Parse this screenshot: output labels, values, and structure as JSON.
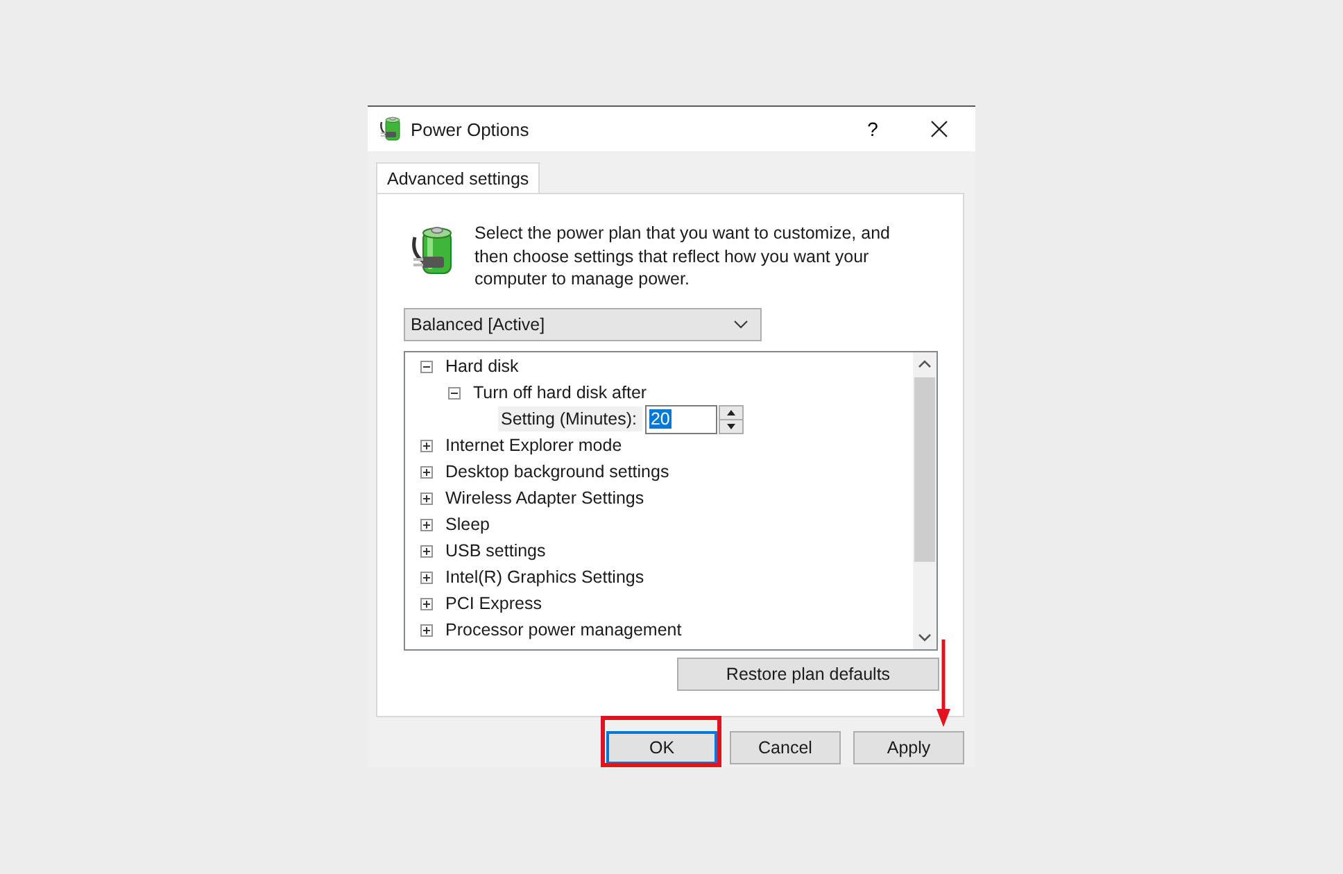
{
  "window": {
    "title": "Power Options",
    "help": "?"
  },
  "tabs": [
    {
      "label": "Advanced settings",
      "selected": true
    }
  ],
  "intro": "Select the power plan that you want to customize, and then choose settings that reflect how you want your computer to manage power.",
  "plan_dropdown": {
    "value": "Balanced [Active]"
  },
  "tree": {
    "items": [
      {
        "kind": "group",
        "label": "Hard disk",
        "expanded": true,
        "selected": false,
        "children": [
          {
            "kind": "group",
            "label": "Turn off hard disk after",
            "expanded": true,
            "selected": false,
            "children": [
              {
                "kind": "setting",
                "label": "Setting (Minutes):",
                "value": "20",
                "selected": true
              }
            ]
          }
        ]
      },
      {
        "kind": "group",
        "label": "Internet Explorer mode",
        "expanded": false,
        "selected": false
      },
      {
        "kind": "group",
        "label": "Desktop background settings",
        "expanded": false,
        "selected": false
      },
      {
        "kind": "group",
        "label": "Wireless Adapter Settings",
        "expanded": false,
        "selected": false
      },
      {
        "kind": "group",
        "label": "Sleep",
        "expanded": false,
        "selected": false
      },
      {
        "kind": "group",
        "label": "USB settings",
        "expanded": false,
        "selected": false
      },
      {
        "kind": "group",
        "label": "Intel(R) Graphics Settings",
        "expanded": false,
        "selected": false
      },
      {
        "kind": "group",
        "label": "PCI Express",
        "expanded": false,
        "selected": false
      },
      {
        "kind": "group",
        "label": "Processor power management",
        "expanded": false,
        "selected": false
      }
    ]
  },
  "restore_button": "Restore plan defaults",
  "buttons": [
    {
      "label": "OK",
      "default": true,
      "highlighted": true,
      "arrow": false
    },
    {
      "label": "Cancel",
      "default": false,
      "highlighted": false,
      "arrow": false
    },
    {
      "label": "Apply",
      "default": false,
      "highlighted": false,
      "arrow": true
    }
  ]
}
